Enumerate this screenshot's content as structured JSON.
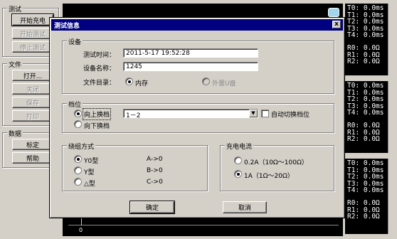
{
  "left_panel": {
    "test_group": {
      "title": "测试",
      "buttons": [
        {
          "label": "开始充电",
          "enabled": true
        },
        {
          "label": "开始测试",
          "enabled": false
        },
        {
          "label": "停止测试",
          "enabled": false
        }
      ]
    },
    "file_group": {
      "title": "文件",
      "buttons": [
        {
          "label": "打开...",
          "enabled": true
        },
        {
          "label": "关闭",
          "enabled": false
        },
        {
          "label": "保存",
          "enabled": false
        },
        {
          "label": "打印",
          "enabled": false
        }
      ]
    },
    "data_group": {
      "title": "数据",
      "buttons": [
        {
          "label": "标定",
          "enabled": true
        },
        {
          "label": "帮助",
          "enabled": true
        }
      ]
    }
  },
  "scope": {
    "axis_zero": "0"
  },
  "readouts": [
    {
      "t": [
        "T0: 0.0ms",
        "T1: 0.0ms",
        "T2: 0.0ms",
        "T3: 0.0ms",
        "T4: 0.0ms"
      ],
      "r": [
        "R0: 0.0Ω",
        "R1: 0.0Ω",
        "R2: 0.0Ω"
      ]
    },
    {
      "t": [
        "T0: 0.0ms",
        "T1: 0.0ms",
        "T2: 0.0ms",
        "T3: 0.0ms",
        "T4: 0.0ms"
      ],
      "r": [
        "R0: 0.0Ω",
        "R1: 0.0Ω",
        "R2: 0.0Ω"
      ]
    },
    {
      "t": [
        "T0: 0.0ms",
        "T1: 0.0ms",
        "T2: 0.0ms",
        "T3: 0.0ms",
        "T4: 0.0ms"
      ],
      "r": [
        "R0: 0.0Ω",
        "R1: 0.0Ω",
        "R2: 0.0Ω"
      ]
    }
  ],
  "dialog": {
    "title": "测试信息",
    "close_symbol": "x",
    "device": {
      "title": "设备",
      "time_label": "测试时间：",
      "time_value": "2011-5-17 19:52:28",
      "name_label": "设备名称：",
      "name_value": "1245",
      "dir_label": "文件目录：",
      "dir_options": [
        {
          "label": "内存",
          "selected": true,
          "enabled": true
        },
        {
          "label": "外置U盘",
          "selected": false,
          "enabled": false
        }
      ]
    },
    "tap": {
      "title": "档位",
      "options": [
        {
          "label": "向上换档",
          "selected": true
        },
        {
          "label": "向下换档",
          "selected": false
        }
      ],
      "select_value": "1－2",
      "auto_switch_label": "自动切换档位",
      "auto_switch_checked": false
    },
    "winding": {
      "title": "绕组方式",
      "options": [
        {
          "label": "Y0型",
          "selected": true,
          "mapping": "A->0"
        },
        {
          "label": "Y型",
          "selected": false,
          "mapping": "B->0"
        },
        {
          "label": "△型",
          "selected": false,
          "mapping": "C->0"
        }
      ]
    },
    "current": {
      "title": "充电电流",
      "options": [
        {
          "label": "0.2A（10Ω～100Ω）",
          "selected": false
        },
        {
          "label": "1A（1Ω～20Ω）",
          "selected": true
        }
      ]
    },
    "ok_label": "确定",
    "cancel_label": "取消"
  }
}
